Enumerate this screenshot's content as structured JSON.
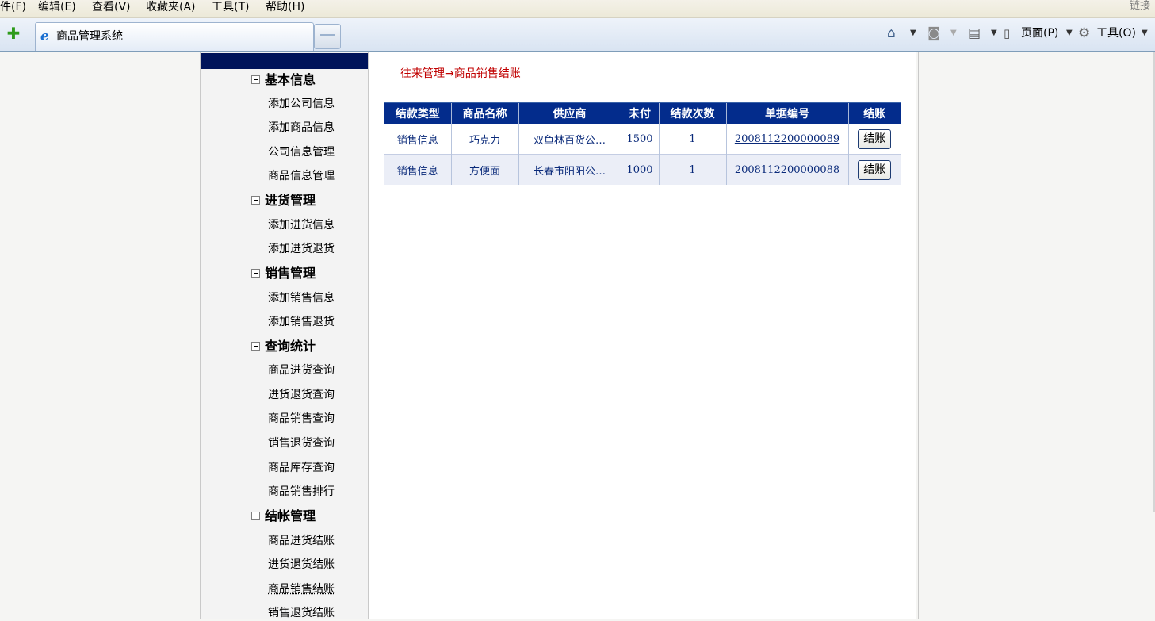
{
  "menubar": {
    "items": [
      "件(F)",
      "编辑(E)",
      "查看(V)",
      "收藏夹(A)",
      "工具(T)",
      "帮助(H)"
    ],
    "links_label": "链接"
  },
  "toolbar": {
    "tab_title": "商品管理系统",
    "page_label": "页面(P)",
    "tools_label": "工具(O)"
  },
  "sidebar": {
    "groups": [
      {
        "label": "基本信息",
        "items": [
          "添加公司信息",
          "添加商品信息",
          "公司信息管理",
          "商品信息管理"
        ]
      },
      {
        "label": "进货管理",
        "items": [
          "添加进货信息",
          "添加进货退货"
        ]
      },
      {
        "label": "销售管理",
        "items": [
          "添加销售信息",
          "添加销售退货"
        ]
      },
      {
        "label": "查询统计",
        "items": [
          "商品进货查询",
          "进货退货查询",
          "商品销售查询",
          "销售退货查询",
          "商品库存查询",
          "商品销售排行"
        ]
      },
      {
        "label": "结帐管理",
        "items": [
          "商品进货结账",
          "进货退货结账",
          "商品销售结账",
          "销售退货结账"
        ]
      }
    ]
  },
  "main": {
    "breadcrumb": "往来管理→商品销售结账",
    "table": {
      "headers": [
        "结款类型",
        "商品名称",
        "供应商",
        "未付",
        "结款次数",
        "单据编号",
        "结账"
      ],
      "rows": [
        {
          "type": "销售信息",
          "product": "巧克力",
          "supplier": "双鱼林百货公…",
          "unpaid": "1500",
          "times": "1",
          "code": "2008112200000089",
          "action": "结账"
        },
        {
          "type": "销售信息",
          "product": "方便面",
          "supplier": "长春市阳阳公…",
          "unpaid": "1000",
          "times": "1",
          "code": "2008112200000088",
          "action": "结账"
        }
      ]
    }
  }
}
